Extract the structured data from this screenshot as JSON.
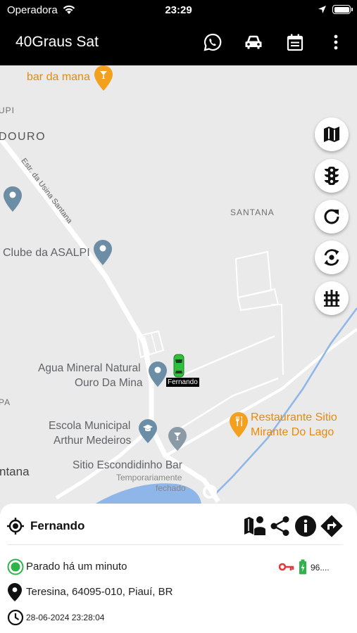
{
  "status_bar": {
    "carrier": "Operadora",
    "time": "23:29"
  },
  "app_bar": {
    "title": "40Graus Sat",
    "actions": [
      {
        "name": "whatsapp-icon"
      },
      {
        "name": "car-icon"
      },
      {
        "name": "calendar-icon"
      },
      {
        "name": "more-vert-icon"
      }
    ]
  },
  "map": {
    "labels": {
      "bar_da_mana": "bar da mana",
      "upi": "UPI",
      "douro": "DOURO",
      "road": "Estr. da Usina Santana",
      "santana": "SANTANA",
      "clube": "Clube da ASALPI",
      "agua_1": "Agua Mineral Natural",
      "agua_2": "Ouro Da Mina",
      "pa": "PA",
      "escola_1": "Escola Municipal",
      "escola_2": "Arthur Medeiros",
      "restaurante_1": "Restaurante Sitio",
      "restaurante_2": "Mirante Do Lago",
      "ntana": "ntana",
      "sitio": "Sitio Escondidinho Bar",
      "temp_1": "Temporariamente",
      "temp_2": "fechado"
    },
    "vehicle_label": "Fernando",
    "colors": {
      "vehicle": "#2fbf3a",
      "poi_orange": "#f2a01d",
      "poi_gray": "#6b8ea6",
      "water": "#8fb6e8"
    }
  },
  "map_controls": [
    {
      "name": "map-layers-icon"
    },
    {
      "name": "traffic-light-icon"
    },
    {
      "name": "refresh-icon"
    },
    {
      "name": "auto-refresh-icon"
    },
    {
      "name": "fence-grid-icon"
    }
  ],
  "panel": {
    "vehicle_name": "Fernando",
    "status": "Parado há um minuto",
    "battery_value": "96....",
    "address": "Teresina, 64095-010, Piauí, BR",
    "datetime": "28-06-2024 23:28:04",
    "colors": {
      "status": "#2fb24a",
      "ignition_key": "#e8363c",
      "battery": "#2fb24a"
    }
  }
}
